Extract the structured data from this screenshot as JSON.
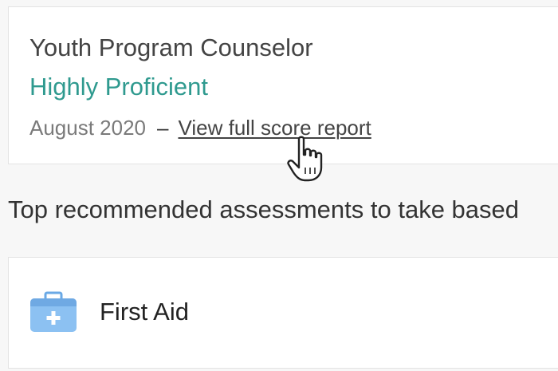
{
  "score_card": {
    "assessment_title": "Youth Program Counselor",
    "proficiency": "Highly Proficient",
    "date": "August 2020",
    "separator": "–",
    "report_link_label": "View full score report"
  },
  "recommendations": {
    "heading": "Top recommended assessments to take based",
    "items": [
      {
        "title": "First Aid",
        "icon": "first-aid-kit-icon"
      }
    ]
  },
  "colors": {
    "proficiency": "#2f9a8f",
    "kit_icon": "#7eb8ef"
  }
}
